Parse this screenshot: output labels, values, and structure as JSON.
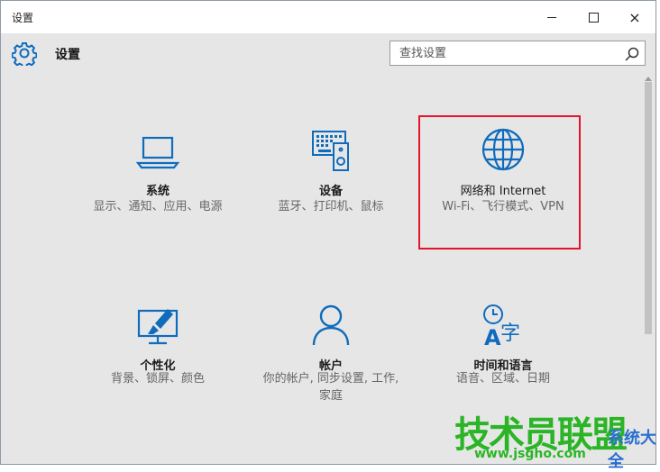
{
  "window": {
    "title": "设置",
    "controls": {
      "minimize": "minimize",
      "maximize": "maximize",
      "close": "×"
    }
  },
  "header": {
    "title": "设置",
    "search_placeholder": "查找设置"
  },
  "tiles": [
    {
      "title": "系统",
      "desc": "显示、通知、应用、电源",
      "icon": "laptop-icon"
    },
    {
      "title": "设备",
      "desc": "蓝牙、打印机、鼠标",
      "icon": "devices-icon"
    },
    {
      "title": "网络和 Internet",
      "desc": "Wi-Fi、飞行模式、VPN",
      "icon": "globe-icon"
    },
    {
      "title": "个性化",
      "desc": "背景、锁屏、颜色",
      "icon": "personalization-icon"
    },
    {
      "title": "帐户",
      "desc": "你的帐户, 同步设置, 工作, 家庭",
      "icon": "account-icon"
    },
    {
      "title": "时间和语言",
      "desc": "语音、区域、日期",
      "icon": "time-language-icon"
    }
  ],
  "watermark": {
    "main": "技术员联盟",
    "sub": "系统大全",
    "url": "www.jsgho.com"
  },
  "colors": {
    "accent": "#0f6cbd",
    "highlight": "#e2152a",
    "window_bg": "#e6e6e6"
  }
}
